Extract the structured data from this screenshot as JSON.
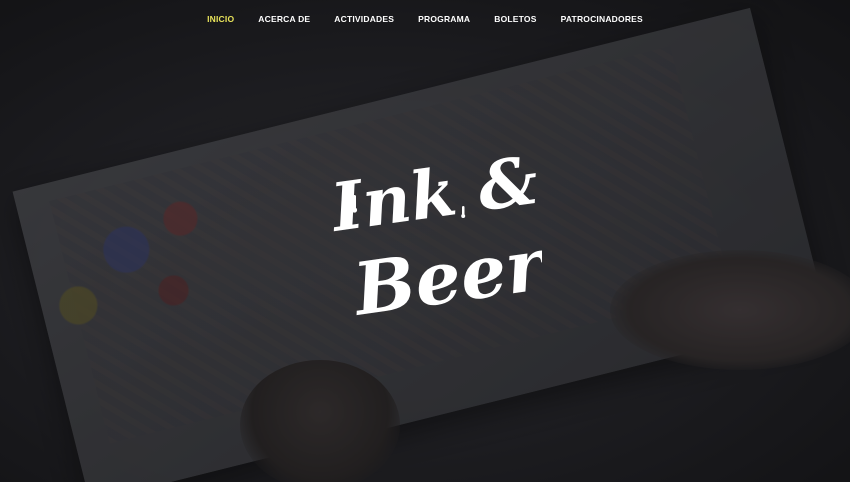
{
  "nav": {
    "items": [
      {
        "label": "INICIO",
        "active": true
      },
      {
        "label": "ACERCA DE",
        "active": false
      },
      {
        "label": "ACTIVIDADES",
        "active": false
      },
      {
        "label": "PROGRAMA",
        "active": false
      },
      {
        "label": "BOLETOS",
        "active": false
      },
      {
        "label": "PATROCINADORES",
        "active": false
      }
    ],
    "active_color": "#e8e35a"
  },
  "logo": {
    "line1": "Ink &",
    "line2": "Beer"
  }
}
